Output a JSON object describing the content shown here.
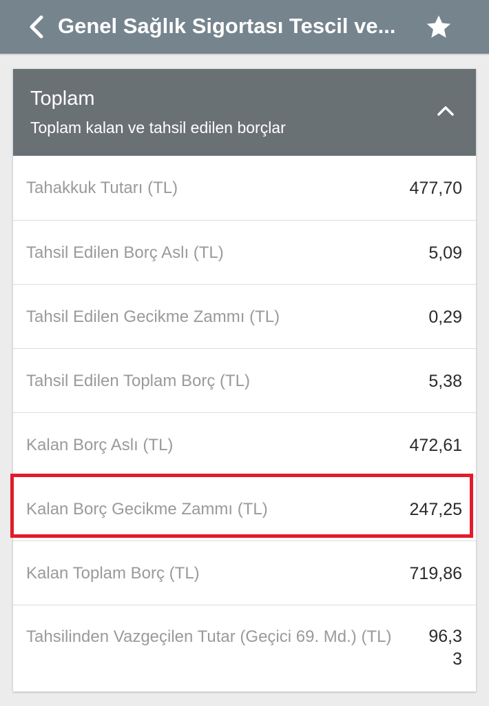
{
  "app_bar": {
    "title": "Genel Sağlık Sigortası Tescil ve...",
    "back_icon": "chevron-left-icon",
    "favorite_icon": "star-icon"
  },
  "card": {
    "title": "Toplam",
    "subtitle": "Toplam kalan ve tahsil edilen borçlar",
    "collapse_icon": "chevron-up-icon",
    "rows": [
      {
        "label": "Tahakkuk Tutarı (TL)",
        "value": "477,70"
      },
      {
        "label": "Tahsil Edilen Borç Aslı (TL)",
        "value": "5,09"
      },
      {
        "label": "Tahsil Edilen Gecikme Zammı (TL)",
        "value": "0,29"
      },
      {
        "label": "Tahsil Edilen Toplam Borç (TL)",
        "value": "5,38"
      },
      {
        "label": "Kalan Borç Aslı (TL)",
        "value": "472,61"
      },
      {
        "label": "Kalan Borç Gecikme Zammı (TL)",
        "value": "247,25"
      },
      {
        "label": "Kalan Toplam Borç (TL)",
        "value": "719,86"
      },
      {
        "label": "Tahsilinden Vazgeçilen Tutar (Geçici 69. Md.) (TL)",
        "value": "96,33"
      }
    ]
  },
  "colors": {
    "app_bar": "#76848e",
    "card_header": "#6a7175",
    "highlight": "#e21b2b"
  }
}
